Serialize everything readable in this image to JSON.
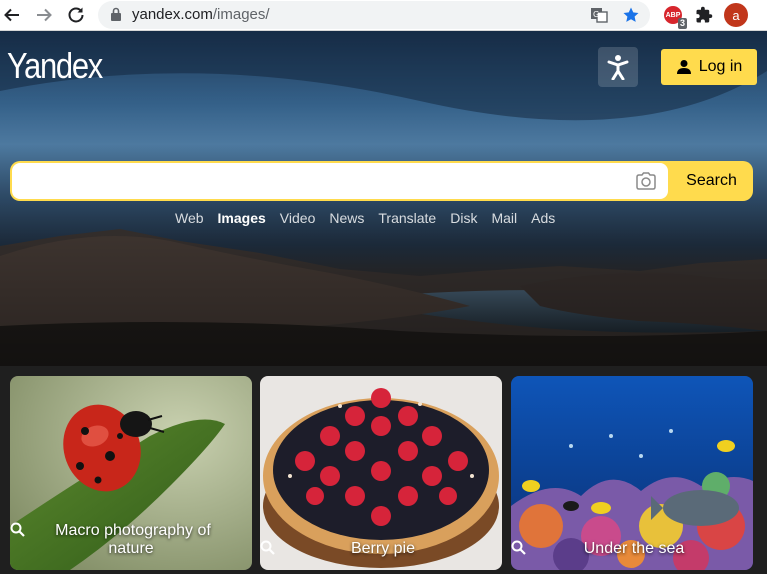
{
  "browser": {
    "url_domain": "yandex.com",
    "url_path": "/images/",
    "adblock_badge_count": "3",
    "adblock_label": "ABP",
    "profile_initial": "a",
    "icons": [
      "back-arrow-icon",
      "forward-arrow-icon",
      "reload-icon",
      "lock-icon",
      "translate-icon",
      "bookmark-star-icon",
      "adblock-icon",
      "extensions-puzzle-icon"
    ]
  },
  "header": {
    "logo": "Yandex",
    "login_label": "Log in",
    "accessibility_icon": "accessibility-person-icon"
  },
  "search": {
    "value": "",
    "placeholder": "",
    "button_label": "Search",
    "camera_icon": "camera-icon"
  },
  "services": [
    {
      "label": "Web",
      "active": false
    },
    {
      "label": "Images",
      "active": true
    },
    {
      "label": "Video",
      "active": false
    },
    {
      "label": "News",
      "active": false
    },
    {
      "label": "Translate",
      "active": false
    },
    {
      "label": "Disk",
      "active": false
    },
    {
      "label": "Mail",
      "active": false
    },
    {
      "label": "Ads",
      "active": false
    }
  ],
  "tiles": [
    {
      "caption": "Macro photography of nature"
    },
    {
      "caption": "Berry pie"
    },
    {
      "caption": "Under the sea"
    }
  ],
  "colors": {
    "accent_yellow": "#ffdb4d",
    "bookmark_blue": "#1a73e8",
    "avatar_red": "#c1361b"
  }
}
